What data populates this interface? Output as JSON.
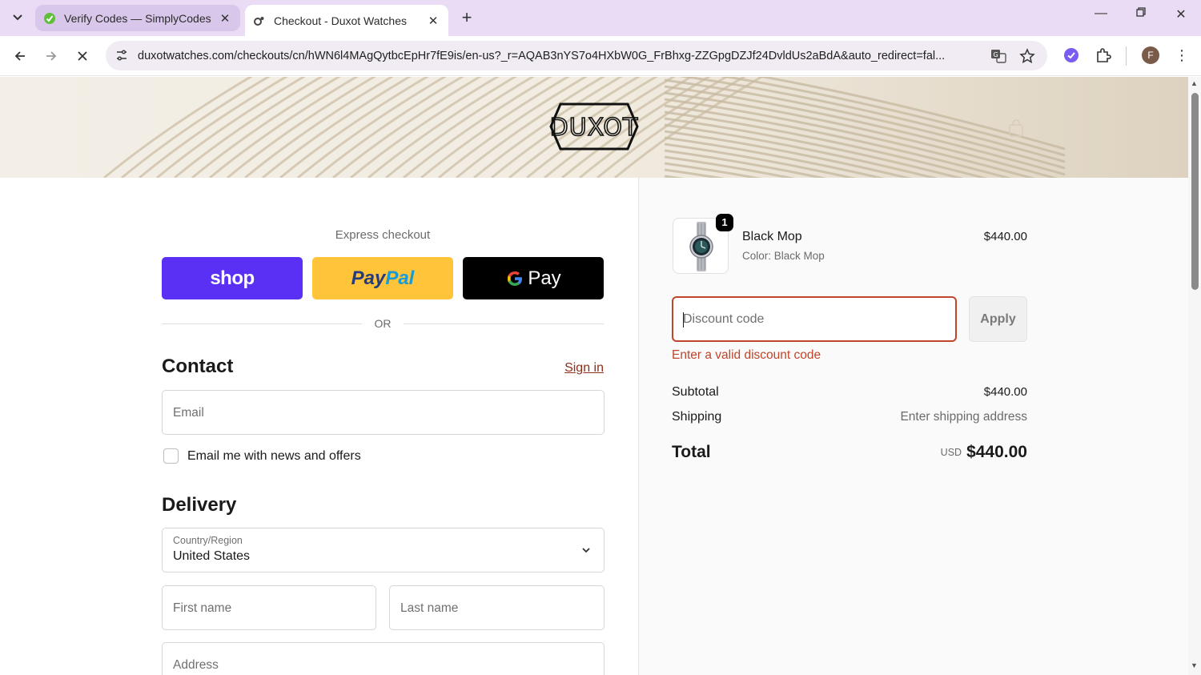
{
  "browser": {
    "tabs": [
      {
        "title": "Verify Codes — SimplyCodes",
        "active": false
      },
      {
        "title": "Checkout - Duxot Watches",
        "active": true
      }
    ],
    "url": "duxotwatches.com/checkouts/cn/hWN6l4MAgQytbcEpHr7fE9is/en-us?_r=AQAB3nYS7o4HXbW0G_FrBhxg-ZZGpgDZJf24DvldUs2aBdA&auto_redirect=fal...",
    "profile_initial": "F",
    "accent_color": "#e9dcf4"
  },
  "header": {
    "logo_text": "DUXOT"
  },
  "checkout": {
    "express_label": "Express checkout",
    "shop_label": "shop",
    "paypal_label_1": "Pay",
    "paypal_label_2": "Pal",
    "gpay_label": "Pay",
    "or_label": "OR",
    "contact_title": "Contact",
    "signin_label": "Sign in",
    "email_placeholder": "Email",
    "newsletter_label": "Email me with news and offers",
    "delivery_title": "Delivery",
    "country_label": "Country/Region",
    "country_value": "United States",
    "first_name_placeholder": "First name",
    "last_name_placeholder": "Last name",
    "address_placeholder": "Address"
  },
  "summary": {
    "item": {
      "name": "Black Mop",
      "variant": "Color: Black Mop",
      "price": "$440.00",
      "quantity": "1"
    },
    "discount_placeholder": "Discount code",
    "apply_label": "Apply",
    "discount_error": "Enter a valid discount code",
    "subtotal_label": "Subtotal",
    "subtotal_value": "$440.00",
    "shipping_label": "Shipping",
    "shipping_value": "Enter shipping address",
    "total_label": "Total",
    "total_currency": "USD",
    "total_value": "$440.00",
    "error_color": "#c0462b"
  }
}
